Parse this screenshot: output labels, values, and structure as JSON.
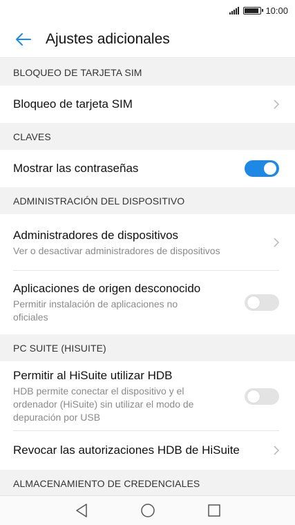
{
  "status_bar": {
    "time": "10:00",
    "battery_level": 0.9
  },
  "app_bar": {
    "title": "Ajustes adicionales",
    "back_icon": "arrow-left-icon"
  },
  "sections": [
    {
      "header": "BLOQUEO DE TARJETA SIM",
      "items": [
        {
          "title": "Bloqueo de tarjeta SIM"
        }
      ]
    },
    {
      "header": "CLAVES",
      "items": [
        {
          "title": "Mostrar las contraseñas",
          "toggle": true
        }
      ]
    },
    {
      "header": "ADMINISTRACIÓN DEL DISPOSITIVO",
      "items": [
        {
          "title": "Administradores de dispositivos",
          "subtitle": "Ver o desactivar administradores de dispositivos"
        },
        {
          "title": "Aplicaciones de origen desconocido",
          "subtitle": "Permitir instalación de aplicaciones no oficiales",
          "toggle": false
        }
      ]
    },
    {
      "header": "PC SUITE (HISUITE)",
      "items": [
        {
          "title": "Permitir al HiSuite utilizar HDB",
          "subtitle": "HDB permite conectar el dispositivo y el ordenador (HiSuite) sin utilizar el modo de depuración por USB",
          "toggle": false
        },
        {
          "title": "Revocar las autorizaciones HDB de HiSuite"
        }
      ]
    },
    {
      "header": "ALMACENAMIENTO DE CREDENCIALES",
      "items": []
    }
  ],
  "nav_bar": {
    "back": "nav-back-icon",
    "home": "nav-home-icon",
    "recents": "nav-recents-icon"
  },
  "colors": {
    "accent": "#1e88e5",
    "section_bg": "#f2f2f2",
    "subtitle": "#8a8a8a"
  }
}
